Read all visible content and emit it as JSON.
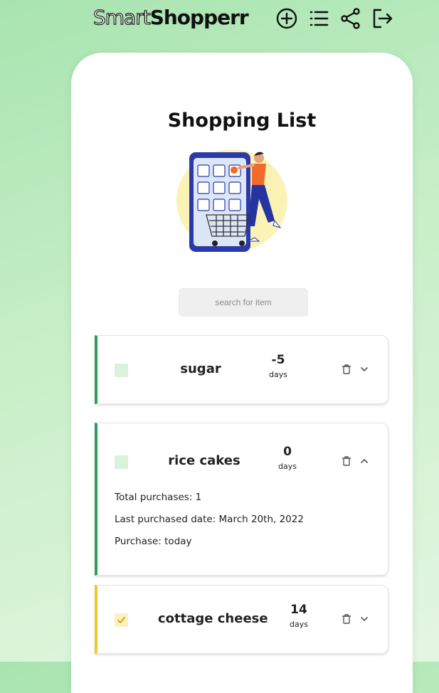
{
  "header": {
    "logo_part1": "Smart",
    "logo_part2": "Shopperr",
    "icons": [
      "add-icon",
      "list-icon",
      "share-icon",
      "logout-icon"
    ]
  },
  "main": {
    "title": "Shopping List",
    "search": {
      "placeholder": "search for item",
      "value": ""
    },
    "items": [
      {
        "name": "sugar",
        "days_value": "-5",
        "days_label": "days",
        "accent": "#2e9e5b",
        "checked": false,
        "expanded": false
      },
      {
        "name": "rice cakes",
        "days_value": "0",
        "days_label": "days",
        "accent": "#2e9e5b",
        "checked": false,
        "expanded": true,
        "details": [
          "Total purchases: 1",
          "Last purchased date: March 20th, 2022",
          "Purchase: today"
        ]
      },
      {
        "name": "cottage cheese",
        "days_value": "14",
        "days_label": "days",
        "accent": "#f2c533",
        "checked": true,
        "expanded": false
      }
    ]
  },
  "colors": {
    "background": "#c8efc8",
    "accent_green": "#2e9e5b",
    "accent_yellow": "#f2c533",
    "checkbox_green": "#d9f2dc",
    "checkbox_yellow": "#fcefc2"
  }
}
